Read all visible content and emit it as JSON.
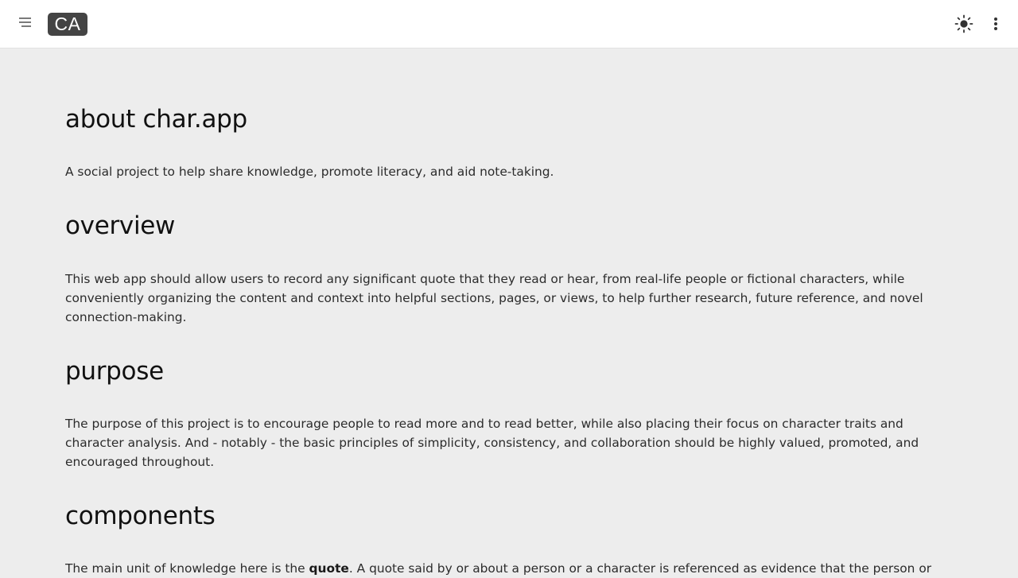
{
  "header": {
    "menu_icon": "hamburger-menu-icon",
    "logo_text": "CA",
    "theme_icon": "sun-icon",
    "more_icon": "vertical-dots-icon"
  },
  "sections": {
    "about": {
      "title": "about char.app",
      "body": "A social project to help share knowledge, promote literacy, and aid note-taking."
    },
    "overview": {
      "title": "overview",
      "body": "This web app should allow users to record any significant quote that they read or hear, from real-life people or fictional characters, while conveniently organizing the content and context into helpful sections, pages, or views, to help further research, future reference, and novel connection-making."
    },
    "purpose": {
      "title": "purpose",
      "body": "The purpose of this project is to encourage people to read more and to read better, while also placing their focus on character traits and character analysis. And - notably - the basic principles of simplicity, consistency, and collaboration should be highly valued, promoted, and encouraged throughout."
    },
    "components": {
      "title": "components",
      "body_before": "The main unit of knowledge here is the ",
      "body_bold": "quote",
      "body_after": ". A quote said by or about a person or a character is referenced as evidence that the person or"
    }
  },
  "colors": {
    "page_background": "#ededed",
    "header_background": "#ffffff",
    "logo_background": "#444444",
    "heading_text": "#111111",
    "body_text": "#2b2b2b"
  }
}
